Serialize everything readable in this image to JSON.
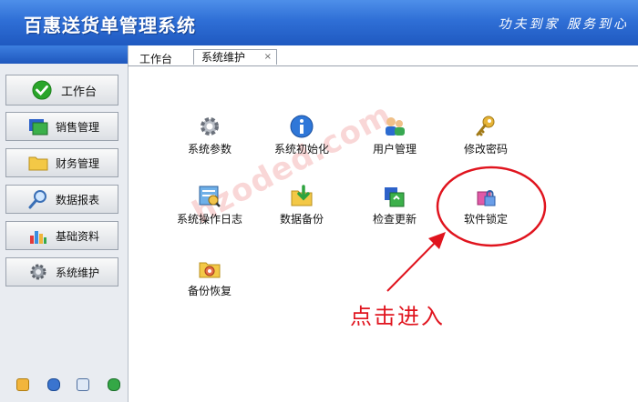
{
  "header": {
    "title": "百惠送货单管理系统",
    "slogan": "功夫到家 服务到心"
  },
  "sidebar": {
    "items": [
      {
        "label": "工作台",
        "icon": "check-icon"
      },
      {
        "label": "销售管理",
        "icon": "window-icon"
      },
      {
        "label": "财务管理",
        "icon": "folder-icon"
      },
      {
        "label": "数据报表",
        "icon": "magnifier-icon"
      },
      {
        "label": "基础资料",
        "icon": "chart-icon"
      },
      {
        "label": "系统维护",
        "icon": "gear-icon"
      }
    ]
  },
  "tabs": [
    {
      "label": "工作台"
    },
    {
      "label": "系统维护",
      "close": "×"
    }
  ],
  "grid": [
    {
      "label": "系统参数",
      "icon": "gear-icon"
    },
    {
      "label": "系统初始化",
      "icon": "info-icon"
    },
    {
      "label": "用户管理",
      "icon": "users-icon"
    },
    {
      "label": "修改密码",
      "icon": "key-icon"
    },
    {
      "label": "系统操作日志",
      "icon": "log-icon"
    },
    {
      "label": "数据备份",
      "icon": "backup-icon"
    },
    {
      "label": "检查更新",
      "icon": "update-icon"
    },
    {
      "label": "软件锁定",
      "icon": "lock-icon"
    },
    {
      "label": "备份恢复",
      "icon": "restore-icon"
    }
  ],
  "watermark": "hzoded.com",
  "annotation": "点击进入",
  "colors": {
    "header": "#2f6fd6",
    "annotation": "#e0141e"
  }
}
